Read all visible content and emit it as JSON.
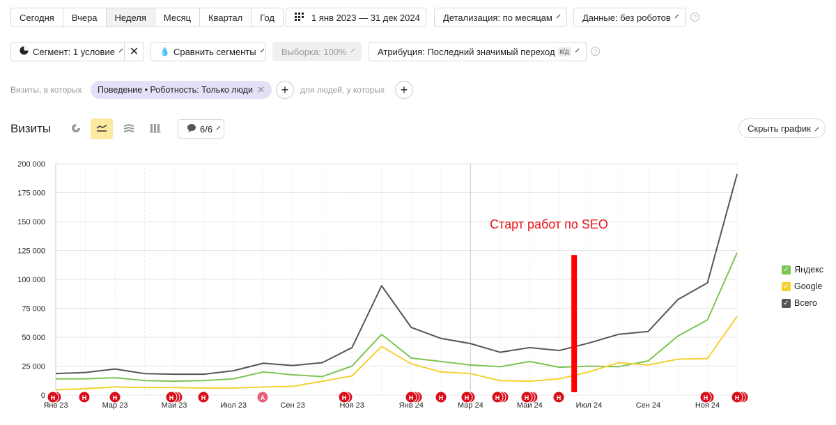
{
  "periods": [
    "Сегодня",
    "Вчера",
    "Неделя",
    "Месяц",
    "Квартал",
    "Год"
  ],
  "active_period_index": 2,
  "date_range": "1 янв 2023 — 31 дек 2024",
  "detail": "Детализация: по месяцам",
  "data_filter": "Данные: без роботов",
  "segment": "Сегмент: 1 условие",
  "compare": "Сравнить сегменты",
  "sample": "Выборка: 100%",
  "attribution": "Атрибуция: Последний значимый переход",
  "attribution_badge": "к/д",
  "filters": {
    "visits_label": "Визиты, в которых",
    "chip": "Поведение • Роботность: Только люди",
    "people_label": "для людей, у которых"
  },
  "report_title": "Визиты",
  "notes_counter": "6/6",
  "hide_chart": "Скрыть график",
  "annotation": "Старт работ по SEO",
  "legend": [
    {
      "name": "Яндекс",
      "color": "#7ec453"
    },
    {
      "name": "Google",
      "color": "#f5d130"
    },
    {
      "name": "Всего",
      "color": "#555555"
    }
  ],
  "chart_data": {
    "type": "line",
    "x": [
      "Янв 23",
      "Фев 23",
      "Мар 23",
      "Апр 23",
      "Май 23",
      "Июн 23",
      "Июл 23",
      "Авг 23",
      "Сен 23",
      "Окт 23",
      "Ноя 23",
      "Дек 23",
      "Янв 24",
      "Фев 24",
      "Мар 24",
      "Апр 24",
      "Май 24",
      "Июн 24",
      "Июл 24",
      "Авг 24",
      "Сен 24",
      "Окт 24",
      "Ноя 24",
      "Дек 24"
    ],
    "x_tick_labels": [
      "Янв 23",
      "Мар 23",
      "Май 23",
      "Июл 23",
      "Сен 23",
      "Ноя 23",
      "Янв 24",
      "Мар 24",
      "Май 24",
      "Июл 24",
      "Сен 24",
      "Ноя 24"
    ],
    "y_ticks": [
      "0",
      "25 000",
      "50 000",
      "75 000",
      "100 000",
      "125 000",
      "150 000",
      "175 000",
      "200 000"
    ],
    "ylim": [
      0,
      200000
    ],
    "series": [
      {
        "name": "Всего",
        "color": "#555555",
        "values": [
          18500,
          19500,
          22500,
          18500,
          18000,
          18000,
          21000,
          27500,
          25500,
          28000,
          41000,
          94500,
          58500,
          49000,
          44500,
          37000,
          41000,
          38500,
          45000,
          52500,
          55000,
          82500,
          97000,
          191000
        ]
      },
      {
        "name": "Яндекс",
        "color": "#7ec453",
        "values": [
          14000,
          14000,
          15000,
          12500,
          12000,
          12500,
          14000,
          20000,
          17500,
          16000,
          25000,
          52500,
          32000,
          29000,
          26000,
          24500,
          29000,
          24000,
          25000,
          24500,
          29500,
          51000,
          65000,
          123000
        ]
      },
      {
        "name": "Google",
        "color": "#f5d130",
        "values": [
          4500,
          5500,
          7000,
          6500,
          6500,
          6000,
          6000,
          7000,
          7500,
          12000,
          16500,
          42000,
          27000,
          20000,
          18500,
          12500,
          12000,
          14000,
          20000,
          28000,
          26000,
          31000,
          31500,
          68000
        ]
      }
    ],
    "marker_month_index": 17.5,
    "marker_value": 121000
  }
}
